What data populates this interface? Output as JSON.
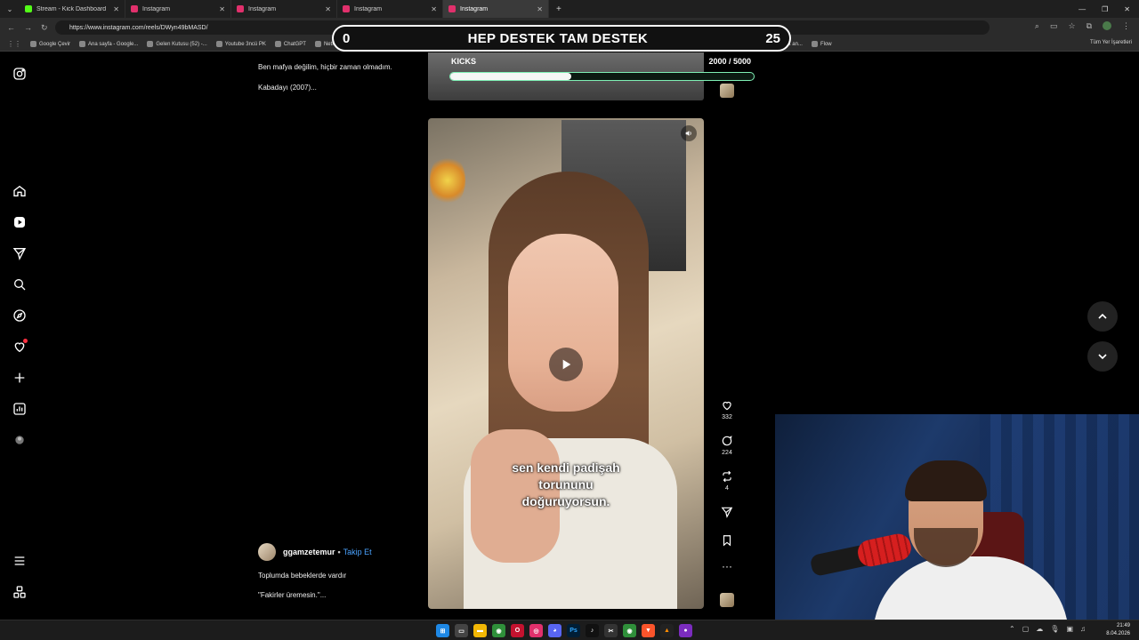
{
  "browser": {
    "tabs": [
      {
        "title": "Stream - Kick Dashboard",
        "color": "#53fc18",
        "active": false
      },
      {
        "title": "Instagram",
        "color": "#e1306c",
        "active": false
      },
      {
        "title": "Instagram",
        "color": "#e1306c",
        "active": false
      },
      {
        "title": "Instagram",
        "color": "#e1306c",
        "active": false
      },
      {
        "title": "Instagram",
        "color": "#e1306c",
        "active": true
      }
    ],
    "new_tab": "+",
    "url": "https://www.instagram.com/reels/DWyn49bMASD/",
    "bookmarks": [
      "Google Çevir",
      "Ana sayfa - Google...",
      "Gelen Kutusu (52) -...",
      "Youtube 3ncü PK",
      "ChatGPT",
      "Netflix",
      "İlaç Örnek",
      "Transcript of \"MI M...",
      "Kabuk Vi...",
      "Tatlı Kahve Dünyası -...",
      "HeyGen - Projects",
      "BURÇ",
      "Esperanza Sahil Gün...",
      "The best ChatBot an...",
      "Flow"
    ],
    "all_bookmarks": "Tüm Yer İşaretleri"
  },
  "stream_overlay": {
    "left_value": "0",
    "title": "HEP DESTEK TAM DESTEK",
    "right_value": "25"
  },
  "kicks": {
    "label": "KICKS",
    "value_text": "2000 / 5000",
    "progress": 0.4
  },
  "prev_post": {
    "line1": "Ben mafya değilim, hiçbir zaman olmadım.",
    "line2": "Kabadayı (2007)..."
  },
  "reel": {
    "caption_lines": [
      "sen kendi padişah",
      "torununu",
      "doğuruyorsun."
    ],
    "likes": "332",
    "comments": "224",
    "reposts": "4"
  },
  "post": {
    "username": "ggamzetemur",
    "separator": "•",
    "follow_label": "Takip Et",
    "line1": "Toplumda bebeklerde vardır",
    "line2": "\"Fakirler üremesin.\"..."
  },
  "clock": {
    "time": "21:49",
    "date": "8.04.2026"
  },
  "colors": {
    "accent_link": "#4aa3ff",
    "progress_border": "#7ff0b5",
    "notification": "#ff3040"
  }
}
